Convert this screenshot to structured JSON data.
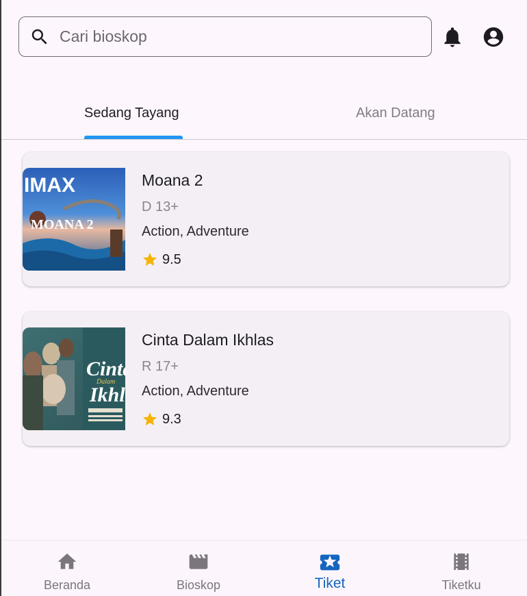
{
  "search": {
    "placeholder": "Cari bioskop"
  },
  "tabs": [
    {
      "label": "Sedang Tayang",
      "active": true
    },
    {
      "label": "Akan Datang",
      "active": false
    }
  ],
  "movies": [
    {
      "title": "Moana 2",
      "age_rating": "D 13+",
      "genre": "Action, Adventure",
      "score": "9.5",
      "poster": {
        "imax_text": "IMAX",
        "logo_text": "MOANA 2"
      }
    },
    {
      "title": "Cinta Dalam Ikhlas",
      "age_rating": "R 17+",
      "genre": "Action, Adventure",
      "score": "9.3",
      "poster": {
        "logo_text": "Cinta",
        "logo_sub": "Dalam",
        "logo_text2": "Ikhlas"
      }
    }
  ],
  "bottom_nav": [
    {
      "label": "Beranda",
      "icon": "home-icon",
      "active": false
    },
    {
      "label": "Bioskop",
      "icon": "clapperboard-icon",
      "active": false
    },
    {
      "label": "Tiket",
      "icon": "ticket-star-icon",
      "active": true
    },
    {
      "label": "Tiketku",
      "icon": "film-strip-icon",
      "active": false
    }
  ],
  "colors": {
    "background": "#fdf7fd",
    "tab_indicator": "#2196f3",
    "active_nav": "#1565c0",
    "star": "#f5b400",
    "card": "#f4eff4"
  }
}
